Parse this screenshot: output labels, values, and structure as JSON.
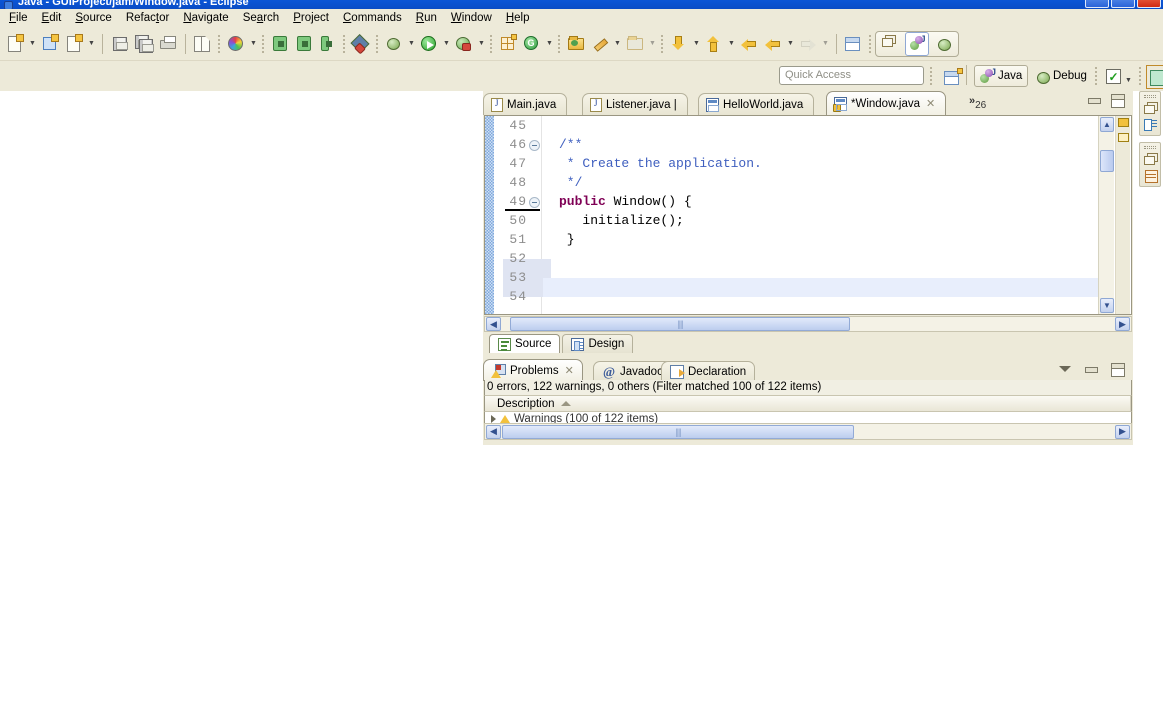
{
  "window": {
    "title": "Java - GUIProject/jam/Window.java - Eclipse",
    "minimize_label": "_",
    "maximize_label": "☐",
    "close_label": "✕"
  },
  "menubar": {
    "items": [
      {
        "label": "File",
        "mnemonic": "F"
      },
      {
        "label": "Edit",
        "mnemonic": "E"
      },
      {
        "label": "Source",
        "mnemonic": "S"
      },
      {
        "label": "Refactor",
        "mnemonic": "t"
      },
      {
        "label": "Navigate",
        "mnemonic": "N"
      },
      {
        "label": "Search",
        "mnemonic": "a"
      },
      {
        "label": "Project",
        "mnemonic": "P"
      },
      {
        "label": "Commands",
        "mnemonic": "C"
      },
      {
        "label": "Run",
        "mnemonic": "R"
      },
      {
        "label": "Window",
        "mnemonic": "W"
      },
      {
        "label": "Help",
        "mnemonic": "H"
      }
    ]
  },
  "toolbar": {
    "buttons": [
      {
        "name": "new-wizard-icon",
        "tooltip": "New"
      },
      {
        "name": "new-android-project-icon",
        "tooltip": "New Android Project"
      },
      {
        "name": "new-java-class-icon",
        "tooltip": "New Java Class"
      },
      {
        "name": "save-icon",
        "tooltip": "Save"
      },
      {
        "name": "save-all-icon",
        "tooltip": "Save All"
      },
      {
        "name": "print-icon",
        "tooltip": "Print"
      },
      {
        "name": "open-type-icon",
        "tooltip": "Open Type"
      },
      {
        "name": "color-wheel-icon",
        "tooltip": "Theme"
      },
      {
        "name": "android-sdk-manager-icon",
        "tooltip": "Android SDK Manager"
      },
      {
        "name": "android-avd-manager-icon",
        "tooltip": "Android Virtual Device Manager"
      },
      {
        "name": "ddms-icon",
        "tooltip": "DDMS"
      },
      {
        "name": "lint-icon",
        "tooltip": "Lint"
      },
      {
        "name": "debug-icon",
        "tooltip": "Debug"
      },
      {
        "name": "run-icon",
        "tooltip": "Run"
      },
      {
        "name": "coverage-icon",
        "tooltip": "Coverage"
      },
      {
        "name": "new-window-builder-icon",
        "tooltip": "WindowBuilder"
      },
      {
        "name": "new-gwt-icon",
        "tooltip": "GWT"
      },
      {
        "name": "open-resource-icon",
        "tooltip": "Open Resource"
      },
      {
        "name": "annotate-icon",
        "tooltip": "Annotate"
      },
      {
        "name": "open-perspective-icon",
        "tooltip": "Open Perspective"
      },
      {
        "name": "step-into-icon",
        "tooltip": "Next Annotation"
      },
      {
        "name": "step-out-icon",
        "tooltip": "Previous Annotation"
      },
      {
        "name": "last-edit-icon",
        "tooltip": "Last Edit Location"
      },
      {
        "name": "back-icon",
        "tooltip": "Back"
      },
      {
        "name": "forward-icon",
        "tooltip": "Forward"
      },
      {
        "name": "new-editor-icon",
        "tooltip": "New Editor"
      }
    ]
  },
  "quick_access": {
    "placeholder": "Quick Access",
    "value": ""
  },
  "perspectives": {
    "open_perspective_tooltip": "Open Perspective",
    "items": [
      {
        "label": "Java",
        "icon": "java-perspective-icon",
        "active": true
      },
      {
        "label": "Debug",
        "icon": "debug-perspective-icon",
        "active": false
      }
    ],
    "checkbox_icon": "checkmark-icon",
    "dropdown_icon": "chevron-down-icon",
    "extra_icon": "new-view-icon"
  },
  "editor": {
    "tabs": [
      {
        "label": "Main.java",
        "icon": "java-file-icon",
        "dirty": false,
        "active": false,
        "warning": false
      },
      {
        "label": "Listener.java |",
        "icon": "java-file-icon",
        "dirty": false,
        "active": false,
        "warning": false
      },
      {
        "label": "HelloWorld.java",
        "icon": "windowbuilder-file-icon",
        "dirty": false,
        "active": false,
        "warning": false
      },
      {
        "label": "*Window.java",
        "icon": "windowbuilder-file-icon",
        "dirty": true,
        "active": true,
        "warning": true
      }
    ],
    "close_glyph": "✕",
    "overflow": {
      "chevrons": "»",
      "count": "26"
    },
    "part_buttons": [
      {
        "name": "editor-minimize-button",
        "glyph": "minimize"
      },
      {
        "name": "editor-maximize-button",
        "glyph": "maximize"
      }
    ],
    "lines": [
      {
        "number": "45",
        "fold": false,
        "text": "",
        "tokens": []
      },
      {
        "number": "46",
        "fold": true,
        "text": "/**",
        "tokens": [
          {
            "t": "/**",
            "c": "cmt"
          }
        ]
      },
      {
        "number": "47",
        "fold": false,
        "text": " * Create the application.",
        "tokens": [
          {
            "t": " * Create the application.",
            "c": "cmt"
          }
        ]
      },
      {
        "number": "48",
        "fold": false,
        "text": " */",
        "tokens": [
          {
            "t": " */",
            "c": "cmt"
          }
        ]
      },
      {
        "number": "49",
        "fold": true,
        "text": "public Window() {",
        "tokens": [
          {
            "t": "public",
            "c": "kw"
          },
          {
            "t": " Window() {",
            "c": ""
          }
        ]
      },
      {
        "number": "50",
        "fold": false,
        "text": "   initialize();",
        "tokens": [
          {
            "t": "   initialize();",
            "c": ""
          }
        ]
      },
      {
        "number": "51",
        "fold": false,
        "text": " }",
        "tokens": [
          {
            "t": " }",
            "c": ""
          }
        ]
      },
      {
        "number": "52",
        "fold": false,
        "text": "",
        "tokens": []
      },
      {
        "number": "53",
        "fold": false,
        "text": "",
        "tokens": []
      },
      {
        "number": "54",
        "fold": false,
        "text": "",
        "tokens": []
      }
    ],
    "scroll": {
      "up_glyph": "▲",
      "down_glyph": "▼",
      "left_glyph": "◀",
      "right_glyph": "▶",
      "grip": "||||"
    },
    "overview_markers": [
      {
        "type": "warning",
        "filled": true
      },
      {
        "type": "warning",
        "filled": false
      }
    ],
    "bottom_tabs": [
      {
        "label": "Source",
        "icon": "source-view-icon",
        "active": true
      },
      {
        "label": "Design",
        "icon": "design-view-icon",
        "active": false
      }
    ]
  },
  "problems_view": {
    "tabs": [
      {
        "label": "Problems",
        "icon": "problems-icon",
        "active": true,
        "closable": true
      },
      {
        "label": "Javadoc",
        "icon": "javadoc-at-icon",
        "active": false,
        "closable": false
      },
      {
        "label": "Declaration",
        "icon": "declaration-icon",
        "active": false,
        "closable": false
      }
    ],
    "close_glyph": "✕",
    "summary": "0 errors, 122 warnings, 0 others (Filter matched 100 of 122 items)",
    "columns": [
      {
        "label": "Description",
        "sorted": "asc"
      }
    ],
    "rows": [
      {
        "expander": true,
        "icon": "warning-icon",
        "description": "Warnings (100 of 122 items)"
      }
    ],
    "part_buttons": [
      {
        "name": "problems-view-menu-button",
        "glyph": "menu"
      },
      {
        "name": "problems-minimize-button",
        "glyph": "minimize"
      },
      {
        "name": "problems-maximize-button",
        "glyph": "maximize"
      }
    ]
  },
  "right_rail": {
    "stacks": [
      {
        "items": [
          {
            "name": "restore-icon",
            "label": "Restore"
          },
          {
            "name": "outline-view-icon",
            "label": "Outline"
          }
        ]
      },
      {
        "items": [
          {
            "name": "restore-icon",
            "label": "Restore"
          },
          {
            "name": "task-list-view-icon",
            "label": "Task List"
          }
        ]
      }
    ]
  },
  "colors": {
    "chrome": "#edead9",
    "titlebar": "#0a50cd",
    "editor_bg": "#ffffff",
    "comment": "#3f5fbf",
    "keyword": "#7f0055",
    "warning": "#f2c13c",
    "line_number": "#8d8d8d",
    "current_line": "#e8eefc"
  }
}
